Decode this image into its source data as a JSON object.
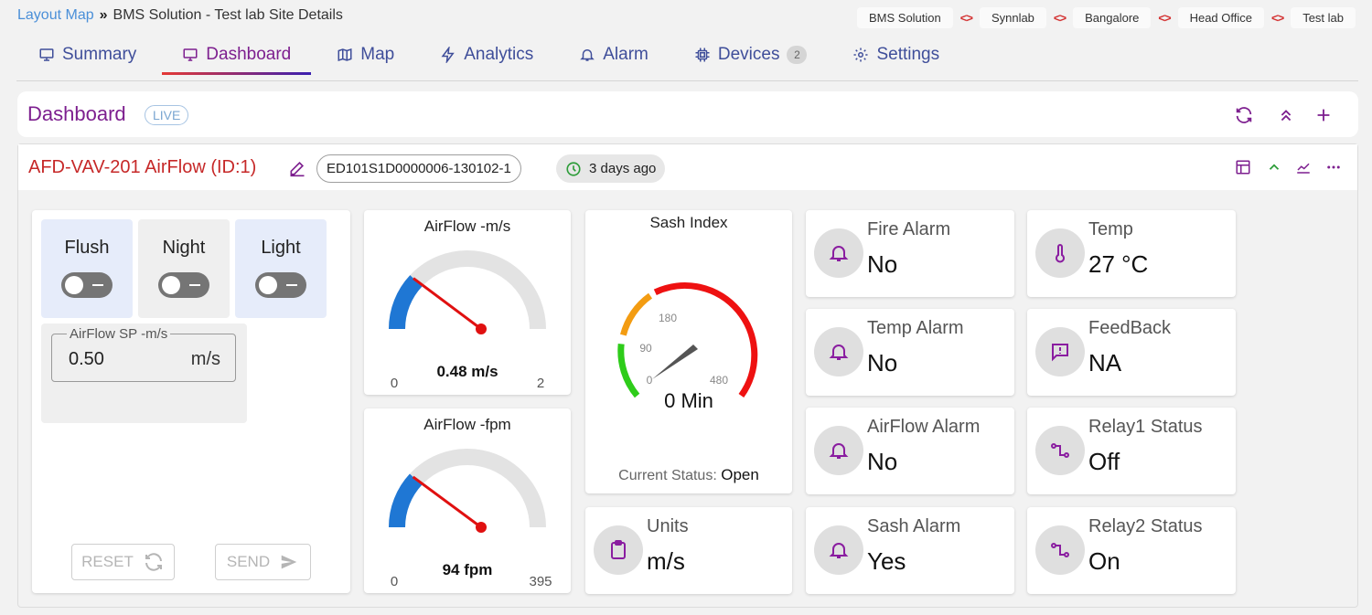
{
  "breadcrumb": {
    "root": "Layout Map",
    "separator": "»",
    "current": "BMS Solution - Test lab Site Details"
  },
  "hierarchy": [
    "BMS Solution",
    "Synnlab",
    "Bangalore",
    "Head Office",
    "Test lab"
  ],
  "hierarchy_sep": "<>",
  "tabs": [
    {
      "label": "Summary",
      "icon": "monitor-icon"
    },
    {
      "label": "Dashboard",
      "icon": "desktop-icon",
      "active": true
    },
    {
      "label": "Map",
      "icon": "map-icon"
    },
    {
      "label": "Analytics",
      "icon": "bolt-icon"
    },
    {
      "label": "Alarm",
      "icon": "bell-icon"
    },
    {
      "label": "Devices",
      "icon": "chip-icon",
      "badge": "2"
    },
    {
      "label": "Settings",
      "icon": "gear-icon"
    }
  ],
  "dashboard": {
    "title": "Dashboard",
    "live": "LIVE"
  },
  "device": {
    "title": "AFD-VAV-201 AirFlow (ID:1)",
    "serial": "ED101S1D0000006-130102-1",
    "last_seen": "3 days ago"
  },
  "controls": {
    "toggles": [
      {
        "label": "Flush",
        "on": false
      },
      {
        "label": "Night",
        "on": false
      },
      {
        "label": "Light",
        "on": false
      }
    ],
    "setpoint": {
      "legend": "AirFlow SP -m/s",
      "value": "0.50",
      "unit": "m/s"
    },
    "reset_label": "RESET",
    "send_label": "SEND"
  },
  "gauge_ms": {
    "title": "AirFlow -m/s",
    "value_label": "0.48 m/s",
    "value": 0.48,
    "min": "0",
    "max": "2",
    "min_v": 0,
    "max_v": 2
  },
  "gauge_fpm": {
    "title": "AirFlow -fpm",
    "value_label": "94 fpm",
    "value": 94,
    "min": "0",
    "max": "395",
    "min_v": 0,
    "max_v": 395
  },
  "sash": {
    "title": "Sash Index",
    "value_label": "0 Min",
    "ticks": [
      "0",
      "90",
      "180",
      "480"
    ],
    "status_label": "Current Status:",
    "status_value": "Open",
    "colors": {
      "ok": "#2ecc1a",
      "warn": "#f39c12",
      "bad": "#ee1111"
    }
  },
  "units": {
    "label": "Units",
    "value": "m/s",
    "icon": "clipboard-icon"
  },
  "alarms": [
    {
      "label": "Fire Alarm",
      "value": "No",
      "icon": "bell-icon"
    },
    {
      "label": "Temp Alarm",
      "value": "No",
      "icon": "bell-icon"
    },
    {
      "label": "AirFlow Alarm",
      "value": "No",
      "icon": "bell-icon"
    },
    {
      "label": "Sash Alarm",
      "value": "Yes",
      "icon": "bell-icon"
    }
  ],
  "stats": [
    {
      "label": "Temp",
      "value": "27 °C",
      "icon": "thermometer-icon"
    },
    {
      "label": "FeedBack",
      "value": "NA",
      "icon": "feedback-icon"
    },
    {
      "label": "Relay1 Status",
      "value": "Off",
      "icon": "relay-icon"
    },
    {
      "label": "Relay2 Status",
      "value": "On",
      "icon": "relay-icon"
    }
  ],
  "colors": {
    "accent": "#7d1f8f",
    "tab": "#3f4e9a",
    "title": "#c62828",
    "gauge_fill": "#1f77d4",
    "needle": "#e01010"
  }
}
